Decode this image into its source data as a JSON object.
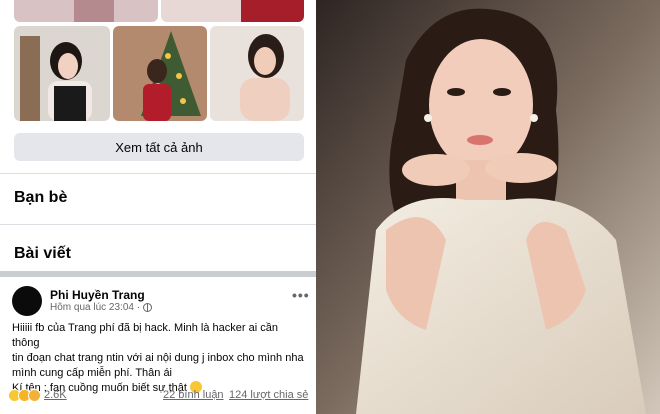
{
  "profile": {
    "see_all_photos_label": "Xem tất cả ảnh",
    "friends_section": "Bạn bè",
    "posts_section": "Bài viết"
  },
  "post": {
    "author": "Phi Huyền Trang",
    "timestamp": "Hôm qua lúc 23:04 · ",
    "privacy_icon": "globe-icon",
    "more_label": "•••",
    "lines": [
      "Hiiiii fb của Trang phí đã bị hack. Minh là hacker ai cần thông",
      "tin đoạn chat trang ntin với ai nội dung j inbox cho mình nha",
      "mình cung cấp miễn phí. Thân ái",
      "Kí tên : fan cuồng muốn biết sự thật"
    ],
    "reaction_count": "2.6K",
    "comments_label": "22 bình luận",
    "shares_label": "124 lượt chia sẻ"
  },
  "colors": {
    "accent_bg": "#e4e6eb",
    "divider": "#dadde1",
    "secondary_text": "#65676b"
  }
}
